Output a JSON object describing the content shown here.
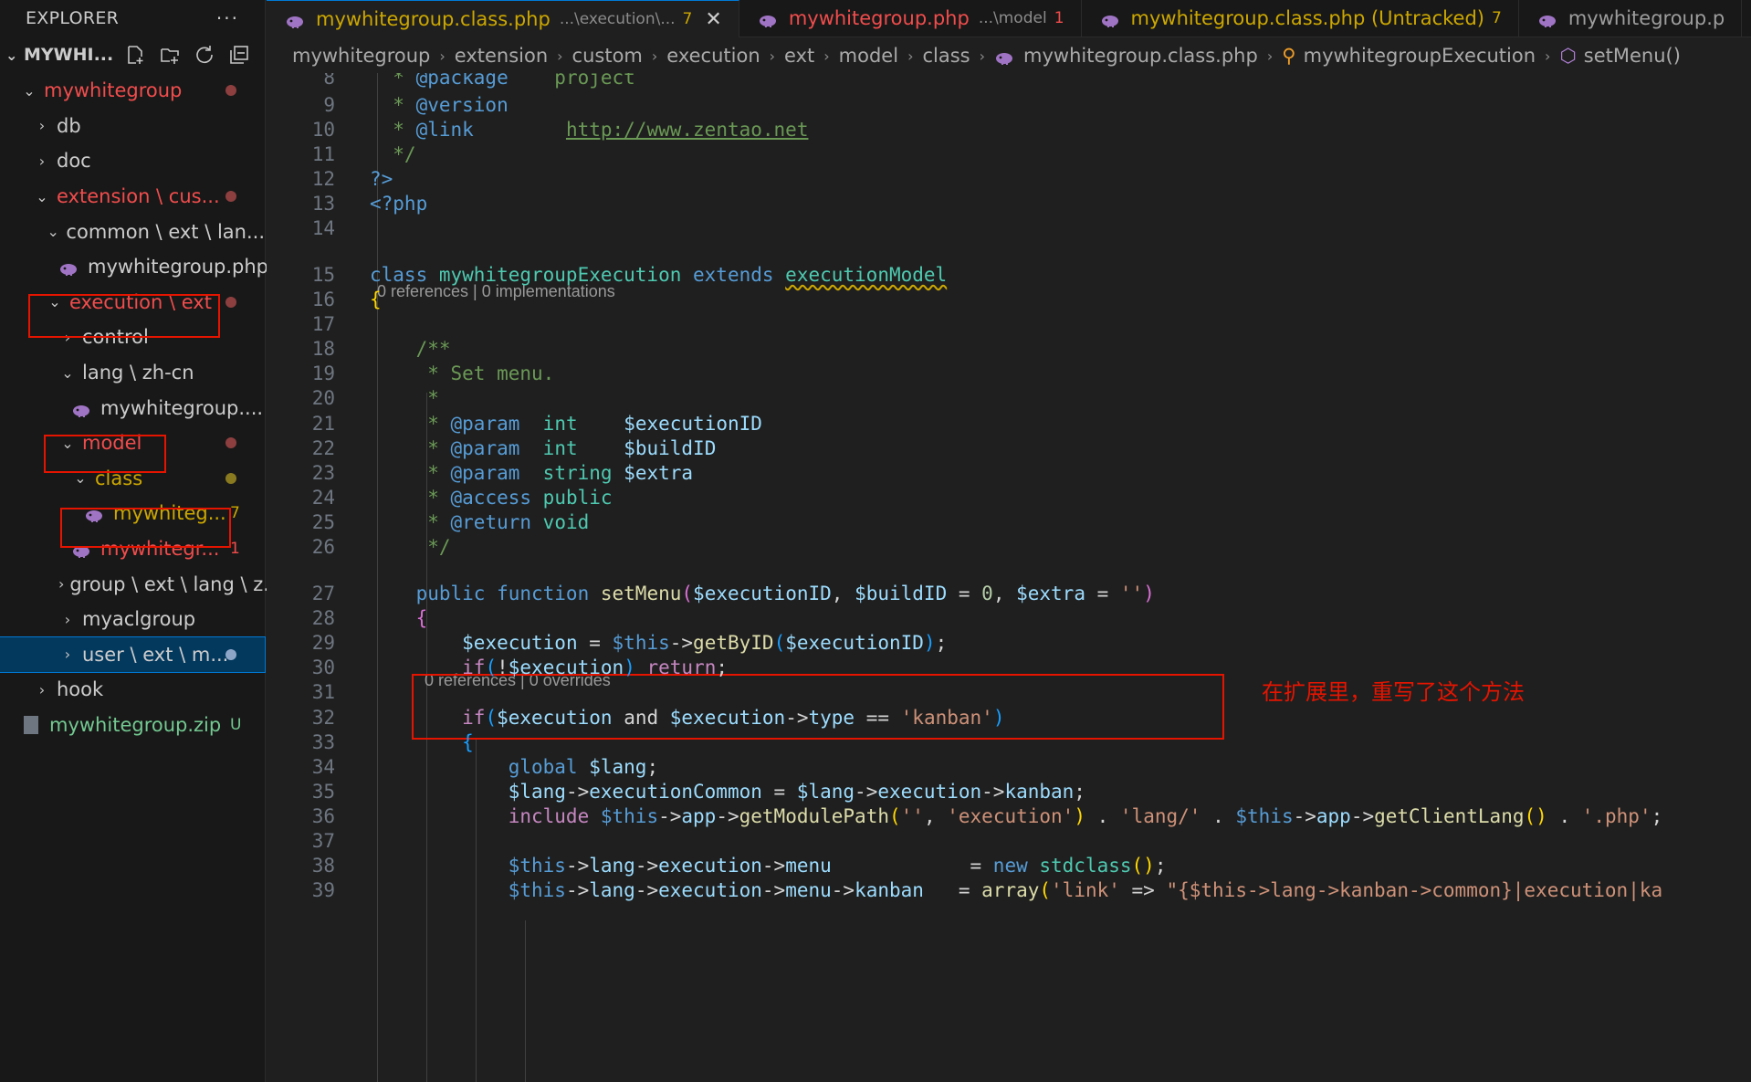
{
  "explorer": {
    "title": "EXPLORER",
    "more": "···",
    "section": "MYWHI...",
    "tree": [
      {
        "label": "mywhitegroup",
        "color": "#f14c4c",
        "chevron": "⌄",
        "dot": true
      },
      {
        "label": "db",
        "color": "#cccccc",
        "chevron": "›"
      },
      {
        "label": "doc",
        "color": "#cccccc",
        "chevron": "›"
      },
      {
        "label": "extension \\ cus...",
        "color": "#f14c4c",
        "chevron": "⌄",
        "dot": true
      },
      {
        "label": "common \\ ext \\ lan...",
        "color": "#cccccc",
        "chevron": "⌄"
      },
      {
        "label": "mywhitegroup.php",
        "color": "#cccccc",
        "icon": "php"
      },
      {
        "label": "execution \\ ext",
        "color": "#f14c4c",
        "chevron": "⌄",
        "dot": true
      },
      {
        "label": "control",
        "color": "#cccccc",
        "chevron": "›"
      },
      {
        "label": "lang \\ zh-cn",
        "color": "#cccccc",
        "chevron": "⌄"
      },
      {
        "label": "mywhitegroup....",
        "color": "#cccccc",
        "icon": "php"
      },
      {
        "label": "model",
        "color": "#f14c4c",
        "chevron": "⌄",
        "dot": true
      },
      {
        "label": "class",
        "color": "#cca700",
        "chevron": "⌄",
        "dot": true,
        "dotcolor": "#8a7a1f"
      },
      {
        "label": "mywhiteg...",
        "color": "#cca700",
        "icon": "php",
        "badge": "7"
      },
      {
        "label": "mywhitegr...",
        "color": "#f14c4c",
        "icon": "php",
        "badge": "1"
      },
      {
        "label": "group \\ ext \\ lang \\ z...",
        "color": "#cccccc",
        "chevron": "›"
      },
      {
        "label": "myaclgroup",
        "color": "#cccccc",
        "chevron": "›"
      },
      {
        "label": "user \\ ext \\ m...",
        "color": "#cccccc",
        "chevron": "›",
        "dot": true,
        "dotcolor": "#8da6c7",
        "selected": true
      },
      {
        "label": "hook",
        "color": "#cccccc",
        "chevron": "›"
      },
      {
        "label": "mywhitegroup.zip",
        "color": "#73c991",
        "icon": "zip",
        "badge": "U"
      }
    ]
  },
  "tabs": [
    {
      "label": "mywhitegroup.class.php",
      "desc": "...\\execution\\...",
      "count": "7",
      "color": "#cca700",
      "active": true,
      "close": "✕"
    },
    {
      "label": "mywhitegroup.php",
      "desc": "...\\model",
      "count": "1",
      "color": "#f14c4c"
    },
    {
      "label": "mywhitegroup.class.php (Untracked)",
      "desc": "",
      "count": "7",
      "color": "#cca700"
    },
    {
      "label": "mywhitegroup.p",
      "desc": "",
      "count": "",
      "color": "#9d9d9d"
    }
  ],
  "breadcrumb": [
    "mywhitegroup",
    "extension",
    "custom",
    "execution",
    "ext",
    "model",
    "class",
    "mywhitegroup.class.php",
    "mywhitegroupExecution",
    "setMenu()"
  ],
  "lens1": "0 references | 0 implementations",
  "lens2": "0 references | 0 overrides",
  "annotation": "在扩展里，重写了这个方法",
  "code": [
    {
      "n": "8",
      "tokens": [
        [
          "  * ",
          "c-cm"
        ],
        [
          "@package",
          "c-kw"
        ],
        [
          "    project",
          "c-cm"
        ]
      ]
    },
    {
      "n": "9",
      "tokens": [
        [
          "  * ",
          "c-cm"
        ],
        [
          "@version",
          "c-kw"
        ]
      ]
    },
    {
      "n": "10",
      "tokens": [
        [
          "  * ",
          "c-cm"
        ],
        [
          "@link",
          "c-kw"
        ],
        [
          "        ",
          "c-cm"
        ],
        [
          "http://www.zentao.net",
          "c-link"
        ]
      ]
    },
    {
      "n": "11",
      "tokens": [
        [
          "  */",
          "c-cm"
        ]
      ]
    },
    {
      "n": "12",
      "tokens": [
        [
          "?>",
          "c-kw"
        ]
      ]
    },
    {
      "n": "13",
      "tokens": [
        [
          "<?php",
          "c-kw"
        ]
      ]
    },
    {
      "n": "14",
      "tokens": []
    },
    {
      "n": "15",
      "tokens": [
        [
          "class ",
          "c-kw"
        ],
        [
          "mywhitegroupExecution",
          "c-cls"
        ],
        [
          " extends ",
          "c-kw"
        ],
        [
          "executionModel",
          "c-cls squiggle"
        ]
      ]
    },
    {
      "n": "16",
      "tokens": [
        [
          "{",
          "c-br"
        ]
      ]
    },
    {
      "n": "17",
      "tokens": []
    },
    {
      "n": "18",
      "tokens": [
        [
          "    /**",
          "c-cm"
        ]
      ]
    },
    {
      "n": "19",
      "tokens": [
        [
          "     * Set menu.",
          "c-cm"
        ]
      ]
    },
    {
      "n": "20",
      "tokens": [
        [
          "     *",
          "c-cm"
        ]
      ]
    },
    {
      "n": "21",
      "tokens": [
        [
          "     * ",
          "c-cm"
        ],
        [
          "@param",
          "c-kw"
        ],
        [
          "  ",
          "c-cm"
        ],
        [
          "int",
          "c-cls"
        ],
        [
          "    ",
          "c-cm"
        ],
        [
          "$executionID",
          "c-var"
        ]
      ]
    },
    {
      "n": "22",
      "tokens": [
        [
          "     * ",
          "c-cm"
        ],
        [
          "@param",
          "c-kw"
        ],
        [
          "  ",
          "c-cm"
        ],
        [
          "int",
          "c-cls"
        ],
        [
          "    ",
          "c-cm"
        ],
        [
          "$buildID",
          "c-var"
        ]
      ]
    },
    {
      "n": "23",
      "tokens": [
        [
          "     * ",
          "c-cm"
        ],
        [
          "@param",
          "c-kw"
        ],
        [
          "  ",
          "c-cm"
        ],
        [
          "string",
          "c-cls"
        ],
        [
          " ",
          "c-cm"
        ],
        [
          "$extra",
          "c-var"
        ]
      ]
    },
    {
      "n": "24",
      "tokens": [
        [
          "     * ",
          "c-cm"
        ],
        [
          "@access",
          "c-kw"
        ],
        [
          " public",
          "c-cls"
        ]
      ]
    },
    {
      "n": "25",
      "tokens": [
        [
          "     * ",
          "c-cm"
        ],
        [
          "@return",
          "c-kw"
        ],
        [
          " void",
          "c-cls"
        ]
      ]
    },
    {
      "n": "26",
      "tokens": [
        [
          "     */",
          "c-cm"
        ]
      ]
    },
    {
      "n": "27",
      "tokens": [
        [
          "    public function ",
          "c-kw"
        ],
        [
          "setMenu",
          "c-fn"
        ],
        [
          "(",
          "c-br2"
        ],
        [
          "$executionID",
          "c-var"
        ],
        [
          ", ",
          "c-op"
        ],
        [
          "$buildID",
          "c-var"
        ],
        [
          " = ",
          "c-op"
        ],
        [
          "0",
          "c-num"
        ],
        [
          ", ",
          "c-op"
        ],
        [
          "$extra",
          "c-var"
        ],
        [
          " = ",
          "c-op"
        ],
        [
          "''",
          "c-str"
        ],
        [
          ")",
          "c-br2"
        ]
      ]
    },
    {
      "n": "28",
      "tokens": [
        [
          "    {",
          "c-br2"
        ]
      ]
    },
    {
      "n": "29",
      "tokens": [
        [
          "        ",
          "c-op"
        ],
        [
          "$execution",
          "c-var"
        ],
        [
          " = ",
          "c-op"
        ],
        [
          "$this",
          "c-kw"
        ],
        [
          "->",
          "c-op"
        ],
        [
          "getByID",
          "c-fn"
        ],
        [
          "(",
          "c-br3"
        ],
        [
          "$executionID",
          "c-var"
        ],
        [
          ")",
          "c-br3"
        ],
        [
          ";",
          "c-op"
        ]
      ]
    },
    {
      "n": "30",
      "tokens": [
        [
          "        ",
          "c-op"
        ],
        [
          "if",
          "c-ctl"
        ],
        [
          "(",
          "c-br3"
        ],
        [
          "!",
          "c-op"
        ],
        [
          "$execution",
          "c-var"
        ],
        [
          ")",
          "c-br3"
        ],
        [
          " return",
          "c-ctl"
        ],
        [
          ";",
          "c-op"
        ]
      ]
    },
    {
      "n": "31",
      "tokens": []
    },
    {
      "n": "32",
      "tokens": [
        [
          "        ",
          "c-op"
        ],
        [
          "if",
          "c-ctl"
        ],
        [
          "(",
          "c-br3"
        ],
        [
          "$execution",
          "c-var"
        ],
        [
          " and ",
          "c-op"
        ],
        [
          "$execution",
          "c-var"
        ],
        [
          "->",
          "c-op"
        ],
        [
          "type",
          "c-var"
        ],
        [
          " == ",
          "c-op"
        ],
        [
          "'kanban'",
          "c-str"
        ],
        [
          ")",
          "c-br3"
        ]
      ]
    },
    {
      "n": "33",
      "tokens": [
        [
          "        {",
          "c-br3"
        ]
      ]
    },
    {
      "n": "34",
      "tokens": [
        [
          "            ",
          "c-op"
        ],
        [
          "global ",
          "c-kw"
        ],
        [
          "$lang",
          "c-var"
        ],
        [
          ";",
          "c-op"
        ]
      ]
    },
    {
      "n": "35",
      "tokens": [
        [
          "            ",
          "c-op"
        ],
        [
          "$lang",
          "c-var"
        ],
        [
          "->",
          "c-op"
        ],
        [
          "executionCommon",
          "c-var"
        ],
        [
          " = ",
          "c-op"
        ],
        [
          "$lang",
          "c-var"
        ],
        [
          "->",
          "c-op"
        ],
        [
          "execution",
          "c-var"
        ],
        [
          "->",
          "c-op"
        ],
        [
          "kanban",
          "c-var"
        ],
        [
          ";",
          "c-op"
        ]
      ]
    },
    {
      "n": "36",
      "tokens": [
        [
          "            ",
          "c-op"
        ],
        [
          "include ",
          "c-ctl"
        ],
        [
          "$this",
          "c-kw"
        ],
        [
          "->",
          "c-op"
        ],
        [
          "app",
          "c-var"
        ],
        [
          "->",
          "c-op"
        ],
        [
          "getModulePath",
          "c-fn"
        ],
        [
          "(",
          "c-br"
        ],
        [
          "''",
          "c-str"
        ],
        [
          ", ",
          "c-op"
        ],
        [
          "'execution'",
          "c-str"
        ],
        [
          ")",
          "c-br"
        ],
        [
          " . ",
          "c-op"
        ],
        [
          "'lang/'",
          "c-str"
        ],
        [
          " . ",
          "c-op"
        ],
        [
          "$this",
          "c-kw"
        ],
        [
          "->",
          "c-op"
        ],
        [
          "app",
          "c-var"
        ],
        [
          "->",
          "c-op"
        ],
        [
          "getClientLang",
          "c-fn"
        ],
        [
          "()",
          "c-br"
        ],
        [
          " . ",
          "c-op"
        ],
        [
          "'.php'",
          "c-str"
        ],
        [
          ";",
          "c-op"
        ]
      ]
    },
    {
      "n": "37",
      "tokens": []
    },
    {
      "n": "38",
      "tokens": [
        [
          "            ",
          "c-op"
        ],
        [
          "$this",
          "c-kw"
        ],
        [
          "->",
          "c-op"
        ],
        [
          "lang",
          "c-var"
        ],
        [
          "->",
          "c-op"
        ],
        [
          "execution",
          "c-var"
        ],
        [
          "->",
          "c-op"
        ],
        [
          "menu",
          "c-var"
        ],
        [
          "            = ",
          "c-op"
        ],
        [
          "new ",
          "c-kw"
        ],
        [
          "stdclass",
          "c-cls"
        ],
        [
          "()",
          "c-br"
        ],
        [
          ";",
          "c-op"
        ]
      ]
    },
    {
      "n": "39",
      "tokens": [
        [
          "            ",
          "c-op"
        ],
        [
          "$this",
          "c-kw"
        ],
        [
          "->",
          "c-op"
        ],
        [
          "lang",
          "c-var"
        ],
        [
          "->",
          "c-op"
        ],
        [
          "execution",
          "c-var"
        ],
        [
          "->",
          "c-op"
        ],
        [
          "menu",
          "c-var"
        ],
        [
          "->",
          "c-op"
        ],
        [
          "kanban",
          "c-var"
        ],
        [
          "   = ",
          "c-op"
        ],
        [
          "array",
          "c-fn"
        ],
        [
          "(",
          "c-br"
        ],
        [
          "'link'",
          "c-str"
        ],
        [
          " => ",
          "c-op"
        ],
        [
          "\"{$this->lang->kanban->common}|execution|ka",
          "c-str"
        ]
      ]
    }
  ]
}
